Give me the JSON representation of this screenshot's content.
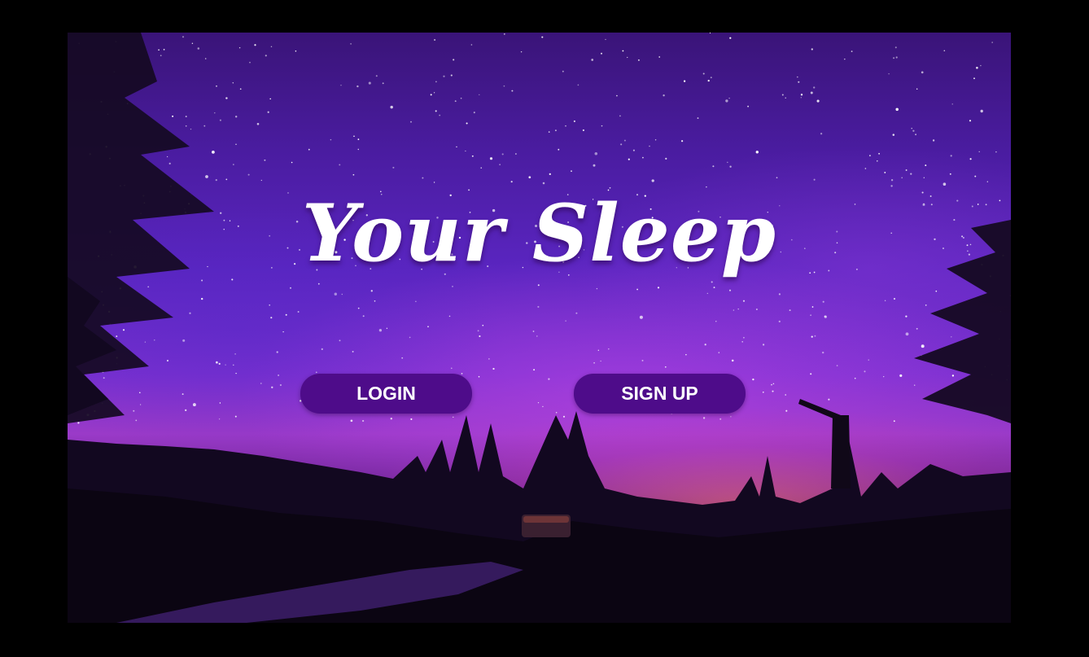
{
  "app": {
    "title": "Your Sleep"
  },
  "actions": {
    "login_label": "LOGIN",
    "signup_label": "SIGN UP"
  },
  "colors": {
    "button_bg": "#4e0c8a",
    "button_text": "#ffffff",
    "title_text": "#ffffff",
    "page_bg": "#000000"
  },
  "background": {
    "scene": "starry-night-sky-over-lake-with-pine-trees"
  }
}
